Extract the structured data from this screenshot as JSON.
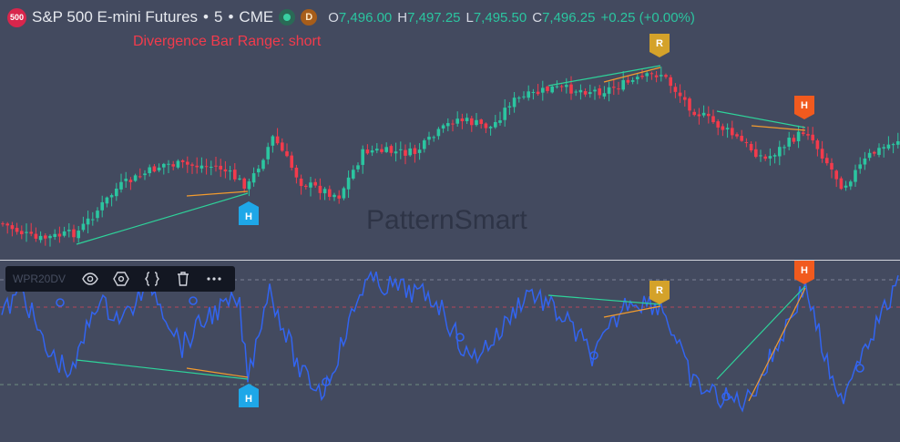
{
  "header": {
    "logo_text": "500",
    "symbol": "S&P 500 E-mini Futures",
    "sep1": "•",
    "interval": "5",
    "sep2": "•",
    "exchange": "CME",
    "d_badge": "D",
    "open_label": "O",
    "open": "7,496.00",
    "high_label": "H",
    "high": "7,497.25",
    "low_label": "L",
    "low": "7,495.50",
    "close_label": "C",
    "close": "7,496.25",
    "change": "+0.25 (+0.00%)"
  },
  "annotation": "Divergence Bar Range: short",
  "watermark": "PatternSmart",
  "indicator": {
    "name": "WPR20DV",
    "icons": [
      "eye-icon",
      "settings-hexagon-icon",
      "code-braces-icon",
      "trash-icon",
      "more-icon"
    ]
  },
  "markers": [
    {
      "label": "H",
      "color": "#1ea7e8",
      "pane": "price"
    },
    {
      "label": "R",
      "color": "#d4a22a",
      "pane": "price"
    },
    {
      "label": "H",
      "color": "#f15a1e",
      "pane": "price"
    },
    {
      "label": "H",
      "color": "#1ea7e8",
      "pane": "oscillator"
    },
    {
      "label": "R",
      "color": "#d4a22a",
      "pane": "oscillator"
    },
    {
      "label": "H",
      "color": "#f15a1e",
      "pane": "oscillator"
    }
  ],
  "colors": {
    "background": "#434a5f",
    "up_candle": "#2bc5a0",
    "down_candle": "#f23b4c",
    "oscillator_line": "#3264f0",
    "divergence_green": "#2ed39a",
    "divergence_orange": "#f29b2e"
  }
}
